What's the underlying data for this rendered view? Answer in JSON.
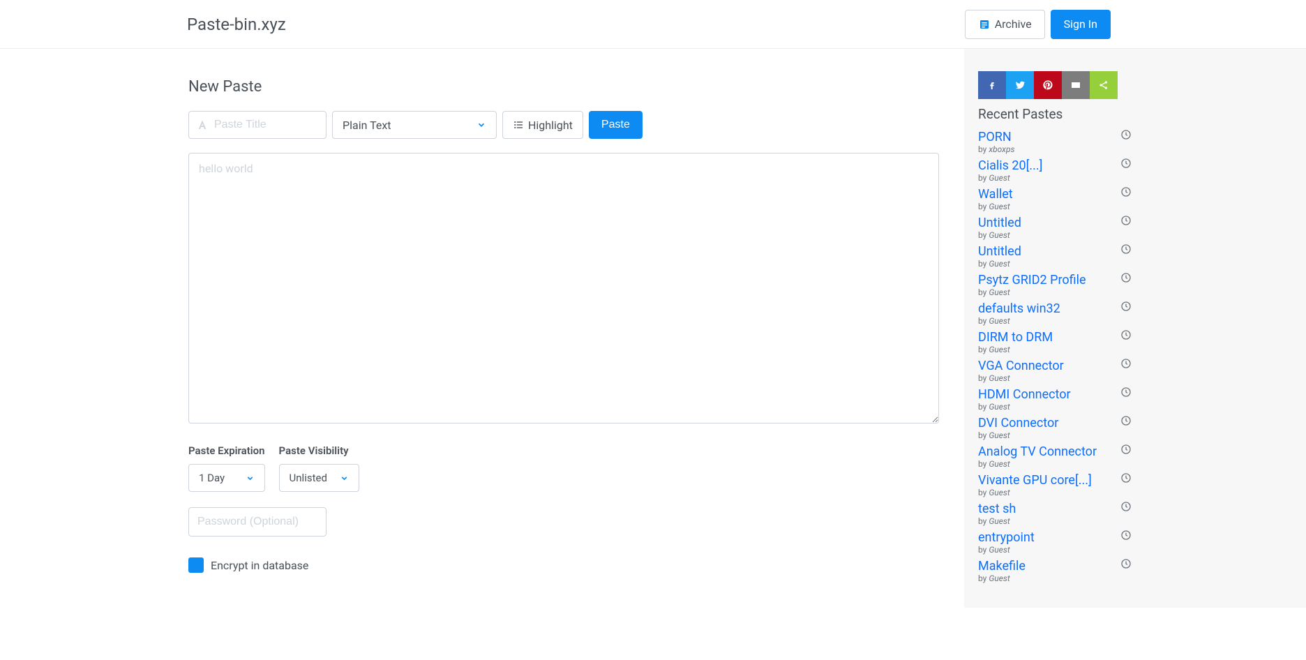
{
  "brand": "Paste-bin.xyz",
  "header": {
    "archive": "Archive",
    "signin": "Sign In"
  },
  "form": {
    "heading": "New Paste",
    "title_placeholder": "Paste Title",
    "syntax_selected": "Plain Text",
    "highlight_label": "Highlight",
    "paste_button": "Paste",
    "content_placeholder": "hello world",
    "expiration_label": "Paste Expiration",
    "expiration_selected": "1 Day",
    "visibility_label": "Paste Visibility",
    "visibility_selected": "Unlisted",
    "password_placeholder": "Password (Optional)",
    "encrypt_label": "Encrypt in database"
  },
  "sidebar": {
    "recent_title": "Recent Pastes",
    "pastes": [
      {
        "title": "PORN",
        "author": "xboxps"
      },
      {
        "title": "Cialis 20[...]",
        "author": "Guest"
      },
      {
        "title": "Wallet",
        "author": "Guest"
      },
      {
        "title": "Untitled",
        "author": "Guest"
      },
      {
        "title": "Untitled",
        "author": "Guest"
      },
      {
        "title": "Psytz GRID2 Profile",
        "author": "Guest"
      },
      {
        "title": "defaults win32",
        "author": "Guest"
      },
      {
        "title": "DIRM to DRM",
        "author": "Guest"
      },
      {
        "title": "VGA Connector",
        "author": "Guest"
      },
      {
        "title": "HDMI Connector",
        "author": "Guest"
      },
      {
        "title": "DVI Connector",
        "author": "Guest"
      },
      {
        "title": "Analog TV Connector",
        "author": "Guest"
      },
      {
        "title": "Vivante GPU core[...]",
        "author": "Guest"
      },
      {
        "title": "test sh",
        "author": "Guest"
      },
      {
        "title": "entrypoint",
        "author": "Guest"
      },
      {
        "title": "Makefile",
        "author": "Guest"
      }
    ]
  }
}
